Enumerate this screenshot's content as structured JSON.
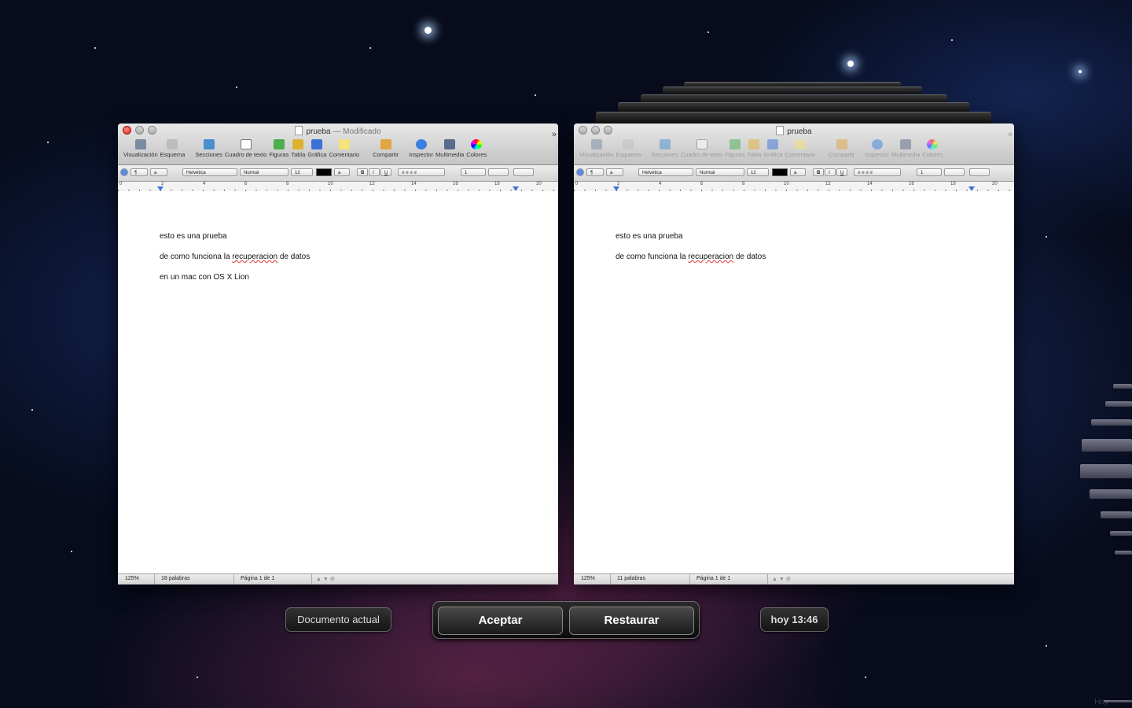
{
  "toolbar_items": [
    {
      "label": "Visualización",
      "icon": "view-icon",
      "color": "#7a8ba0"
    },
    {
      "label": "Esquema",
      "icon": "outline-icon",
      "color": "#a7a7a7"
    },
    {
      "label": "Secciones",
      "icon": "sections-icon",
      "color": "#4a8fd0"
    },
    {
      "label": "Cuadro de texto",
      "icon": "textbox-icon",
      "color": "#9a9a9a"
    },
    {
      "label": "Figuras",
      "icon": "shapes-icon",
      "color": "#4cae4c"
    },
    {
      "label": "Tabla",
      "icon": "table-icon",
      "color": "#e0b030"
    },
    {
      "label": "Gráfica",
      "icon": "chart-icon",
      "color": "#3c72d6"
    },
    {
      "label": "Comentario",
      "icon": "comment-icon",
      "color": "#f5e27a"
    },
    {
      "label": "Compartir",
      "icon": "share-icon",
      "color": "#e0a640"
    },
    {
      "label": "Inspector",
      "icon": "inspector-icon",
      "color": "#3a7fe0"
    },
    {
      "label": "Multimedia",
      "icon": "media-icon",
      "color": "#5a6a8a"
    },
    {
      "label": "Colores",
      "icon": "colors-icon",
      "color": "#e85050"
    }
  ],
  "format_bar": {
    "font": "Helvetica",
    "style": "Normal",
    "size": "12",
    "spacing": "1"
  },
  "ruler_numbers": [
    "0",
    "2",
    "4",
    "6",
    "8",
    "10",
    "12",
    "14",
    "16",
    "18",
    "20"
  ],
  "left_window": {
    "title": "prueba",
    "title_suffix": "— Modificado",
    "lines": [
      {
        "before": "esto es una prueba",
        "misspelled": "",
        "after": ""
      },
      {
        "before": "de como funciona la ",
        "misspelled": "recuperacion",
        "after": " de datos"
      },
      {
        "before": "en un mac con OS X Lion",
        "misspelled": "",
        "after": ""
      }
    ],
    "status": {
      "zoom": "125%",
      "words": "18 palabras",
      "page": "Página 1 de 1"
    }
  },
  "right_window": {
    "title": "prueba",
    "lines": [
      {
        "before": "esto es una prueba",
        "misspelled": "",
        "after": ""
      },
      {
        "before": "de como funciona la ",
        "misspelled": "recuperacion",
        "after": " de datos"
      }
    ],
    "status": {
      "zoom": "125%",
      "words": "11 palabras",
      "page": "Página 1 de 1"
    }
  },
  "bottom": {
    "current_label": "Documento actual",
    "accept": "Aceptar",
    "restore": "Restaurar",
    "time_label": "hoy 13:46",
    "timeline_label": "Hoy"
  }
}
